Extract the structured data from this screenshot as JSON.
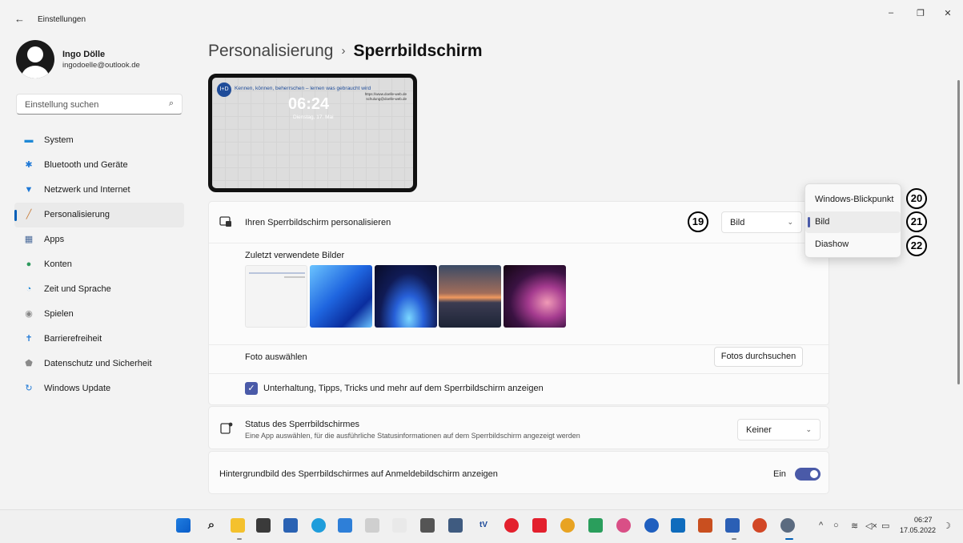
{
  "window": {
    "back_glyph": "←",
    "title": "Einstellungen",
    "minimize_glyph": "–",
    "maximize_glyph": "❐",
    "close_glyph": "✕"
  },
  "user": {
    "name": "Ingo Dölle",
    "email": "ingodoelle@outlook.de"
  },
  "search": {
    "placeholder": "Einstellung suchen",
    "icon_glyph": "⌕"
  },
  "sidebar": {
    "items": [
      {
        "label": "System",
        "icon": "monitor-icon",
        "color": "#1e88d6"
      },
      {
        "label": "Bluetooth und Geräte",
        "icon": "bluetooth-icon",
        "color": "#1e78d6"
      },
      {
        "label": "Netzwerk und Internet",
        "icon": "wifi-icon",
        "color": "#1e78d6"
      },
      {
        "label": "Personalisierung",
        "icon": "brush-icon",
        "color": "#c77b38",
        "active": true
      },
      {
        "label": "Apps",
        "icon": "apps-icon",
        "color": "#4a6a9a"
      },
      {
        "label": "Konten",
        "icon": "person-icon",
        "color": "#2e9a5e"
      },
      {
        "label": "Zeit und Sprache",
        "icon": "globe-clock-icon",
        "color": "#1e88d6"
      },
      {
        "label": "Spielen",
        "icon": "gamepad-icon",
        "color": "#888888"
      },
      {
        "label": "Barrierefreiheit",
        "icon": "accessibility-icon",
        "color": "#1e78d6"
      },
      {
        "label": "Datenschutz und Sicherheit",
        "icon": "shield-icon",
        "color": "#8a8a8a"
      },
      {
        "label": "Windows Update",
        "icon": "update-icon",
        "color": "#1e78d6"
      }
    ]
  },
  "breadcrumb": {
    "parent": "Personalisierung",
    "separator": "›",
    "current": "Sperrbildschirm"
  },
  "preview": {
    "logo": "I+D",
    "slogan": "Kennen, können, beherrschen – lernen was gebraucht wird",
    "time": "06:24",
    "date": "Dienstag, 17. Mai",
    "web": "https://www.doelle-web.de",
    "mail": "schulung@doelle-web.de"
  },
  "personalize": {
    "label": "Ihren Sperrbildschirm personalisieren",
    "dropdown_value": "Bild",
    "recent_label": "Zuletzt verwendete Bilder",
    "choose_label": "Foto auswählen",
    "browse_button": "Fotos durchsuchen",
    "checkbox_label": "Unterhaltung, Tipps, Tricks und mehr auf dem Sperrbildschirm anzeigen"
  },
  "status": {
    "title": "Status des Sperrbildschirmes",
    "subtitle": "Eine App auswählen, für die ausführliche Statusinformationen auf dem Sperrbildschirm angezeigt werden",
    "dropdown_value": "Keiner"
  },
  "background": {
    "label": "Hintergrundbild des Sperrbildschirmes auf Anmeldebildschirm anzeigen",
    "toggle_label": "Ein"
  },
  "menu": {
    "options": [
      "Windows-Blickpunkt",
      "Bild",
      "Diashow"
    ],
    "selected": "Bild"
  },
  "callouts": [
    "19",
    "20",
    "21",
    "22"
  ],
  "chevron_glyph": "⌄",
  "check_glyph": "✓",
  "taskbar": {
    "tray_caret": "^",
    "time": "06:27",
    "date": "17.05.2022"
  },
  "colors": {
    "accent": "#4a5aa8",
    "windows_blue": "#005fb8"
  }
}
